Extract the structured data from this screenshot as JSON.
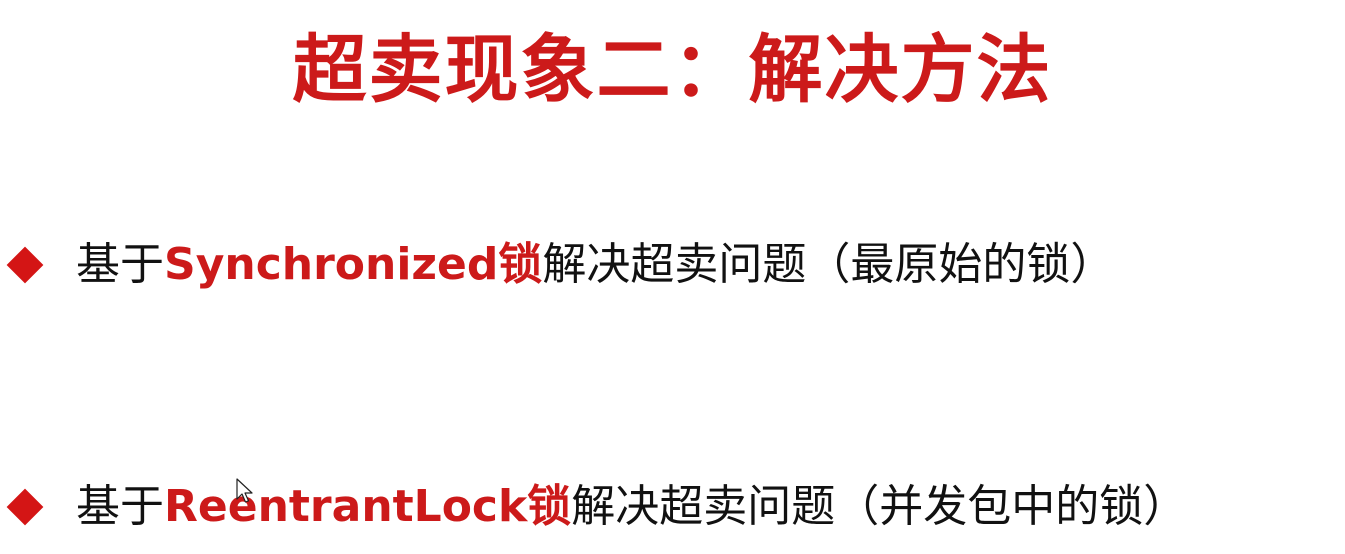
{
  "slide": {
    "title": "超卖现象二：解决方法",
    "accent_color": "#cc1a1a",
    "bullet_color": "#d41515",
    "bullet_icon": "diamond-icon",
    "bullets": [
      {
        "prefix": "基于",
        "highlight": "Synchronized锁",
        "suffix": "解决超卖问题（最原始的锁）"
      },
      {
        "prefix": "基于",
        "highlight": "ReentrantLock锁",
        "suffix": "解决超卖问题（并发包中的锁）"
      }
    ],
    "cursor_icon": "mouse-pointer-icon"
  }
}
